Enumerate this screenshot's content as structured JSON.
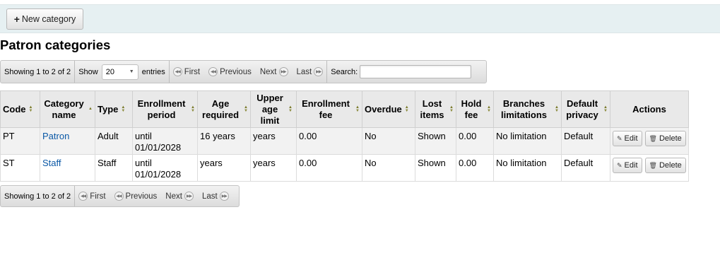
{
  "toolbar": {
    "new_category_label": "New category"
  },
  "page_title": "Patron categories",
  "pager_top": {
    "info": "Showing 1 to 2 of 2",
    "show_label": "Show",
    "entries_value": "20",
    "entries_label": "entries",
    "first": "First",
    "previous": "Previous",
    "next": "Next",
    "last": "Last",
    "search_label": "Search:",
    "search_value": ""
  },
  "pager_bottom": {
    "info": "Showing 1 to 2 of 2",
    "first": "First",
    "previous": "Previous",
    "next": "Next",
    "last": "Last"
  },
  "table": {
    "headers": {
      "code": "Code",
      "category_name": "Category name",
      "type": "Type",
      "enrollment_period": "Enrollment period",
      "age_required": "Age required",
      "upper_age_limit": "Upper age limit",
      "enrollment_fee": "Enrollment fee",
      "overdue": "Overdue",
      "lost_items": "Lost items",
      "hold_fee": "Hold fee",
      "branches_limitations": "Branches limitations",
      "default_privacy": "Default privacy",
      "actions": "Actions"
    },
    "rows": [
      {
        "code": "PT",
        "name": "Patron",
        "type": "Adult",
        "enrollment_period": "until 01/01/2028",
        "age_required": "16 years",
        "upper_age_limit": "years",
        "enrollment_fee": "0.00",
        "overdue": "No",
        "lost_items": "Shown",
        "hold_fee": "0.00",
        "branches": "No limitation",
        "privacy": "Default",
        "edit": "Edit",
        "delete": "Delete"
      },
      {
        "code": "ST",
        "name": "Staff",
        "type": "Staff",
        "enrollment_period": "until 01/01/2028",
        "age_required": "years",
        "upper_age_limit": "years",
        "enrollment_fee": "0.00",
        "overdue": "No",
        "lost_items": "Shown",
        "hold_fee": "0.00",
        "branches": "No limitation",
        "privacy": "Default",
        "edit": "Edit",
        "delete": "Delete"
      }
    ]
  }
}
